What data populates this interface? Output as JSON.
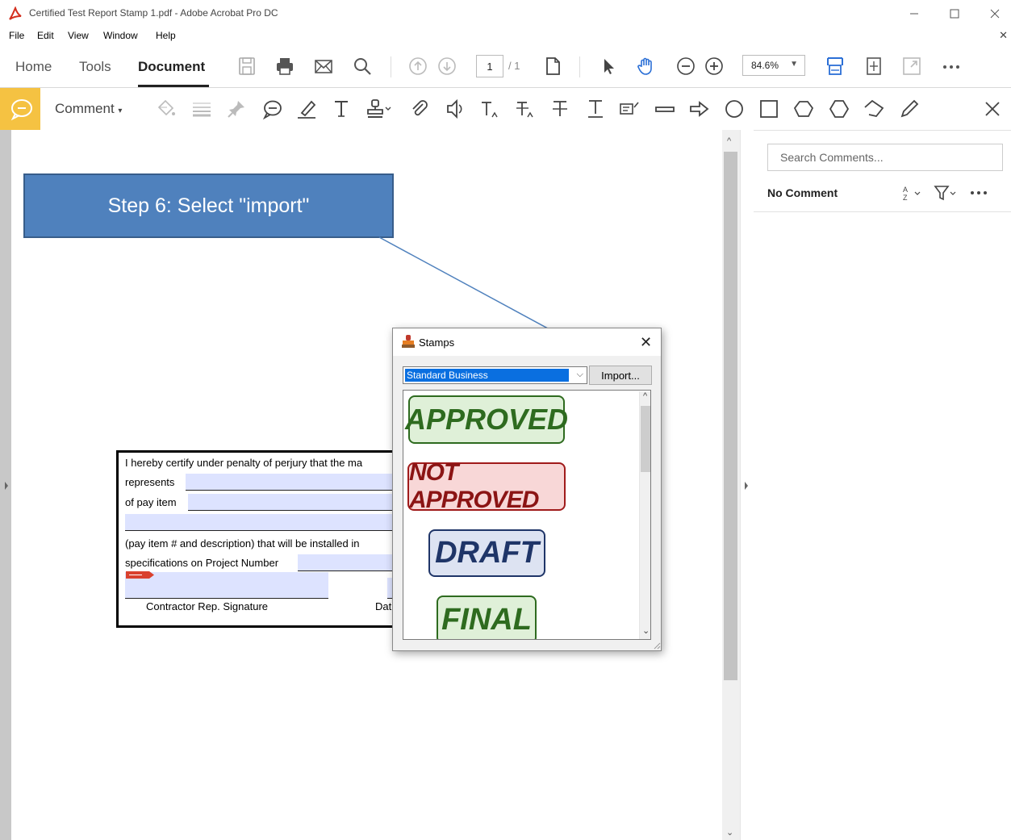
{
  "window": {
    "title": "Certified Test Report Stamp 1.pdf - Adobe Acrobat Pro DC"
  },
  "menu": [
    "File",
    "Edit",
    "View",
    "Window",
    "Help"
  ],
  "toolbar": {
    "tabs": [
      "Home",
      "Tools",
      "Document"
    ],
    "active_tab": "Document",
    "page_current": "1",
    "page_total": "/ 1",
    "zoom": "84.6%"
  },
  "comment_toolbar": {
    "label": "Comment"
  },
  "comments_pane": {
    "search_placeholder": "Search Comments...",
    "status": "No Comment"
  },
  "callout": {
    "text": "Step 6: Select \"import\""
  },
  "form": {
    "line1": "I hereby certify under penalty of perjury that the ma",
    "line2": "represents",
    "line3": "of pay item",
    "line4": "(pay item # and description)  that will be installed in",
    "line5": "specifications on Project Number",
    "sig_label": "Contractor Rep. Signature",
    "date_label": "Dat"
  },
  "stamps_dialog": {
    "title": "Stamps",
    "category": "Standard Business",
    "import_label": "Import...",
    "stamps": [
      {
        "label": "APPROVED",
        "color": "#2e6b1f",
        "bg": "#dff0d8",
        "border": "#2e6b1f"
      },
      {
        "label": "NOT APPROVED",
        "color": "#8b1414",
        "bg": "#f8d7d7",
        "border": "#a01b1b"
      },
      {
        "label": "DRAFT",
        "color": "#1f3568",
        "bg": "#dde3f2",
        "border": "#1f3568"
      },
      {
        "label": "FINAL",
        "color": "#2e6b1f",
        "bg": "#dff0d8",
        "border": "#2e6b1f"
      }
    ]
  },
  "colors": {
    "accent": "#f5c242",
    "callout_bg": "#4f81bd",
    "field_bg": "#dde3ff",
    "selection": "#0a6fe0"
  }
}
